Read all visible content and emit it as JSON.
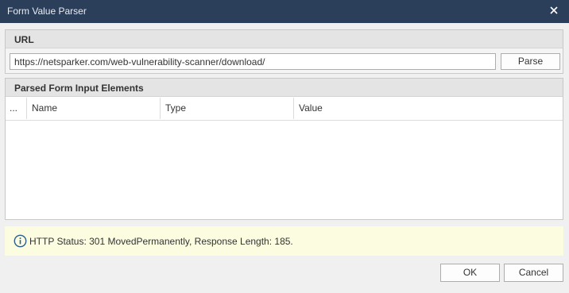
{
  "window": {
    "title": "Form Value Parser",
    "close_icon": "close-icon"
  },
  "url_section": {
    "header": "URL",
    "url_value": "https://netsparker.com/web-vulnerability-scanner/download/",
    "parse_label": "Parse"
  },
  "parsed_section": {
    "header": "Parsed Form Input Elements",
    "columns": [
      "...",
      "Name",
      "Type",
      "Value"
    ]
  },
  "info": {
    "icon": "info-icon",
    "text": "HTTP Status: 301 MovedPermanently, Response Length: 185."
  },
  "buttons": {
    "ok_label": "OK",
    "cancel_label": "Cancel"
  }
}
